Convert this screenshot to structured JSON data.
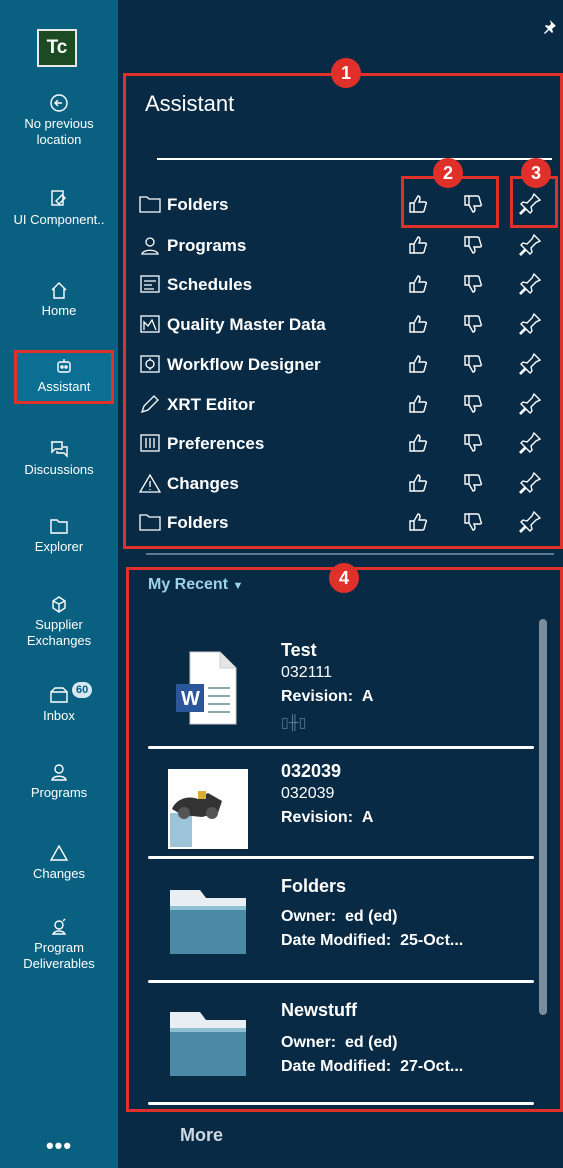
{
  "rail": {
    "logo": "Tc",
    "items": [
      {
        "icon": "back-arrow-icon",
        "label": "No previous location"
      },
      {
        "icon": "ui-component-icon",
        "label": "UI Component.."
      },
      {
        "icon": "home-icon",
        "label": "Home"
      },
      {
        "icon": "assistant-icon",
        "label": "Assistant"
      },
      {
        "icon": "discussions-icon",
        "label": "Discussions"
      },
      {
        "icon": "folder-icon",
        "label": "Explorer"
      },
      {
        "icon": "supplier-exchange-icon",
        "label": "Supplier Exchanges"
      },
      {
        "icon": "inbox-icon",
        "label": "Inbox",
        "badge": "60"
      },
      {
        "icon": "programs-icon",
        "label": "Programs"
      },
      {
        "icon": "changes-icon",
        "label": "Changes"
      },
      {
        "icon": "program-deliverables-icon",
        "label": "Program Deliverables"
      }
    ],
    "more_dots": "•••"
  },
  "assistant": {
    "title": "Assistant",
    "rows": [
      {
        "icon": "folder-icon",
        "label": "Folders"
      },
      {
        "icon": "programs-icon",
        "label": "Programs"
      },
      {
        "icon": "schedules-icon",
        "label": "Schedules"
      },
      {
        "icon": "quality-master-data-icon",
        "label": "Quality Master Data"
      },
      {
        "icon": "workflow-designer-icon",
        "label": "Workflow Designer"
      },
      {
        "icon": "pencil-icon",
        "label": "XRT Editor"
      },
      {
        "icon": "preferences-icon",
        "label": "Preferences"
      },
      {
        "icon": "warning-triangle-icon",
        "label": "Changes"
      },
      {
        "icon": "folder-icon",
        "label": "Folders"
      }
    ]
  },
  "callouts": [
    "1",
    "2",
    "3",
    "4"
  ],
  "recent": {
    "header": "My Recent",
    "items": [
      {
        "title": "Test",
        "id": "032111",
        "rev_label": "Revision:",
        "rev": "A",
        "thumb": "word-document-icon"
      },
      {
        "title": "032039",
        "id": "032039",
        "rev_label": "Revision:",
        "rev": "A",
        "thumb": "part-thumbnail-image"
      },
      {
        "title": "Folders",
        "owner_label": "Owner:",
        "owner": "ed (ed)",
        "date_label": "Date Modified:",
        "date": "25-Oct...",
        "thumb": "folder-thumbnail"
      },
      {
        "title": "Newstuff",
        "owner_label": "Owner:",
        "owner": "ed (ed)",
        "date_label": "Date Modified:",
        "date": "27-Oct...",
        "thumb": "folder-thumbnail"
      }
    ]
  },
  "more_label": "More",
  "colors": {
    "rail": "#0a6080",
    "panel": "#082a45",
    "highlight": "#e0302a",
    "accent": "#9fd1ea"
  }
}
